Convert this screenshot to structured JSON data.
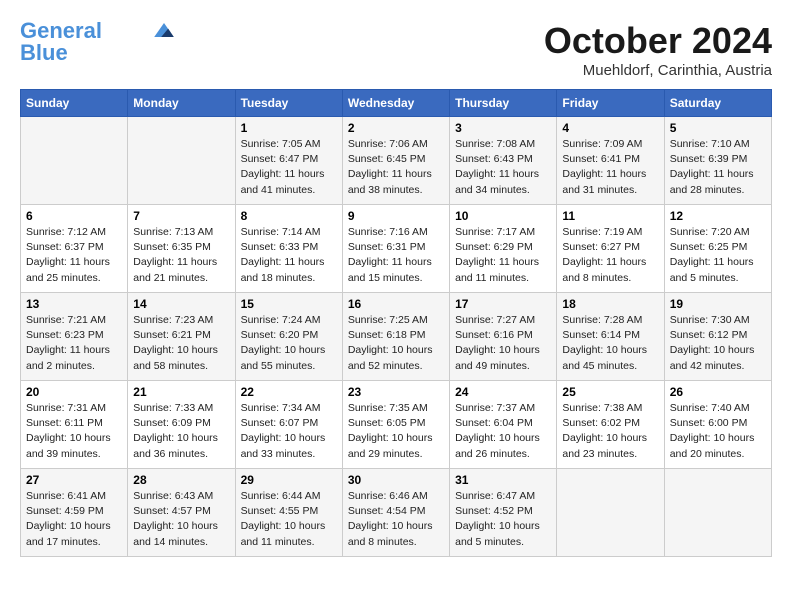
{
  "header": {
    "logo_line1": "General",
    "logo_line2": "Blue",
    "month": "October 2024",
    "location": "Muehldorf, Carinthia, Austria"
  },
  "weekdays": [
    "Sunday",
    "Monday",
    "Tuesday",
    "Wednesday",
    "Thursday",
    "Friday",
    "Saturday"
  ],
  "weeks": [
    [
      {
        "day": "",
        "info": ""
      },
      {
        "day": "",
        "info": ""
      },
      {
        "day": "1",
        "info": "Sunrise: 7:05 AM\nSunset: 6:47 PM\nDaylight: 11 hours and 41 minutes."
      },
      {
        "day": "2",
        "info": "Sunrise: 7:06 AM\nSunset: 6:45 PM\nDaylight: 11 hours and 38 minutes."
      },
      {
        "day": "3",
        "info": "Sunrise: 7:08 AM\nSunset: 6:43 PM\nDaylight: 11 hours and 34 minutes."
      },
      {
        "day": "4",
        "info": "Sunrise: 7:09 AM\nSunset: 6:41 PM\nDaylight: 11 hours and 31 minutes."
      },
      {
        "day": "5",
        "info": "Sunrise: 7:10 AM\nSunset: 6:39 PM\nDaylight: 11 hours and 28 minutes."
      }
    ],
    [
      {
        "day": "6",
        "info": "Sunrise: 7:12 AM\nSunset: 6:37 PM\nDaylight: 11 hours and 25 minutes."
      },
      {
        "day": "7",
        "info": "Sunrise: 7:13 AM\nSunset: 6:35 PM\nDaylight: 11 hours and 21 minutes."
      },
      {
        "day": "8",
        "info": "Sunrise: 7:14 AM\nSunset: 6:33 PM\nDaylight: 11 hours and 18 minutes."
      },
      {
        "day": "9",
        "info": "Sunrise: 7:16 AM\nSunset: 6:31 PM\nDaylight: 11 hours and 15 minutes."
      },
      {
        "day": "10",
        "info": "Sunrise: 7:17 AM\nSunset: 6:29 PM\nDaylight: 11 hours and 11 minutes."
      },
      {
        "day": "11",
        "info": "Sunrise: 7:19 AM\nSunset: 6:27 PM\nDaylight: 11 hours and 8 minutes."
      },
      {
        "day": "12",
        "info": "Sunrise: 7:20 AM\nSunset: 6:25 PM\nDaylight: 11 hours and 5 minutes."
      }
    ],
    [
      {
        "day": "13",
        "info": "Sunrise: 7:21 AM\nSunset: 6:23 PM\nDaylight: 11 hours and 2 minutes."
      },
      {
        "day": "14",
        "info": "Sunrise: 7:23 AM\nSunset: 6:21 PM\nDaylight: 10 hours and 58 minutes."
      },
      {
        "day": "15",
        "info": "Sunrise: 7:24 AM\nSunset: 6:20 PM\nDaylight: 10 hours and 55 minutes."
      },
      {
        "day": "16",
        "info": "Sunrise: 7:25 AM\nSunset: 6:18 PM\nDaylight: 10 hours and 52 minutes."
      },
      {
        "day": "17",
        "info": "Sunrise: 7:27 AM\nSunset: 6:16 PM\nDaylight: 10 hours and 49 minutes."
      },
      {
        "day": "18",
        "info": "Sunrise: 7:28 AM\nSunset: 6:14 PM\nDaylight: 10 hours and 45 minutes."
      },
      {
        "day": "19",
        "info": "Sunrise: 7:30 AM\nSunset: 6:12 PM\nDaylight: 10 hours and 42 minutes."
      }
    ],
    [
      {
        "day": "20",
        "info": "Sunrise: 7:31 AM\nSunset: 6:11 PM\nDaylight: 10 hours and 39 minutes."
      },
      {
        "day": "21",
        "info": "Sunrise: 7:33 AM\nSunset: 6:09 PM\nDaylight: 10 hours and 36 minutes."
      },
      {
        "day": "22",
        "info": "Sunrise: 7:34 AM\nSunset: 6:07 PM\nDaylight: 10 hours and 33 minutes."
      },
      {
        "day": "23",
        "info": "Sunrise: 7:35 AM\nSunset: 6:05 PM\nDaylight: 10 hours and 29 minutes."
      },
      {
        "day": "24",
        "info": "Sunrise: 7:37 AM\nSunset: 6:04 PM\nDaylight: 10 hours and 26 minutes."
      },
      {
        "day": "25",
        "info": "Sunrise: 7:38 AM\nSunset: 6:02 PM\nDaylight: 10 hours and 23 minutes."
      },
      {
        "day": "26",
        "info": "Sunrise: 7:40 AM\nSunset: 6:00 PM\nDaylight: 10 hours and 20 minutes."
      }
    ],
    [
      {
        "day": "27",
        "info": "Sunrise: 6:41 AM\nSunset: 4:59 PM\nDaylight: 10 hours and 17 minutes."
      },
      {
        "day": "28",
        "info": "Sunrise: 6:43 AM\nSunset: 4:57 PM\nDaylight: 10 hours and 14 minutes."
      },
      {
        "day": "29",
        "info": "Sunrise: 6:44 AM\nSunset: 4:55 PM\nDaylight: 10 hours and 11 minutes."
      },
      {
        "day": "30",
        "info": "Sunrise: 6:46 AM\nSunset: 4:54 PM\nDaylight: 10 hours and 8 minutes."
      },
      {
        "day": "31",
        "info": "Sunrise: 6:47 AM\nSunset: 4:52 PM\nDaylight: 10 hours and 5 minutes."
      },
      {
        "day": "",
        "info": ""
      },
      {
        "day": "",
        "info": ""
      }
    ]
  ]
}
